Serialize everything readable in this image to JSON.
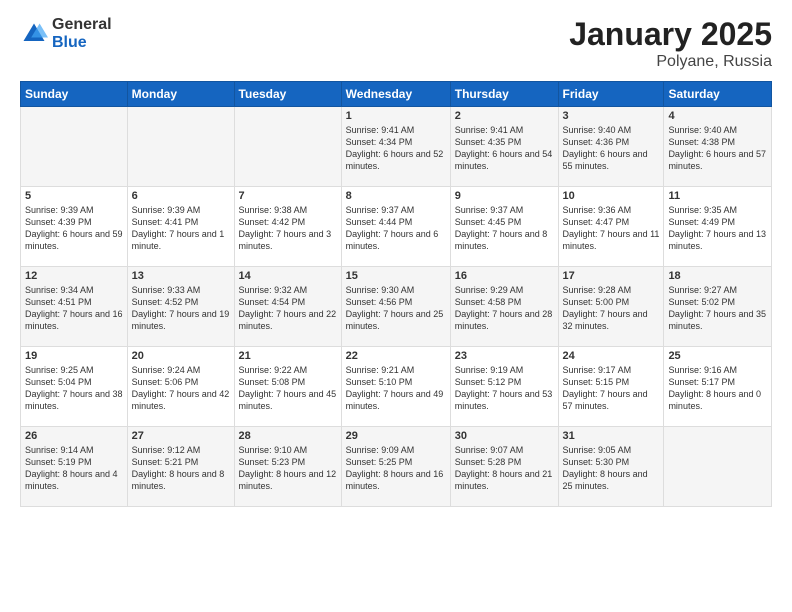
{
  "logo": {
    "general": "General",
    "blue": "Blue"
  },
  "title": {
    "month": "January 2025",
    "location": "Polyane, Russia"
  },
  "weekdays": [
    "Sunday",
    "Monday",
    "Tuesday",
    "Wednesday",
    "Thursday",
    "Friday",
    "Saturday"
  ],
  "weeks": [
    [
      {
        "day": "",
        "info": ""
      },
      {
        "day": "",
        "info": ""
      },
      {
        "day": "",
        "info": ""
      },
      {
        "day": "1",
        "info": "Sunrise: 9:41 AM\nSunset: 4:34 PM\nDaylight: 6 hours and 52 minutes."
      },
      {
        "day": "2",
        "info": "Sunrise: 9:41 AM\nSunset: 4:35 PM\nDaylight: 6 hours and 54 minutes."
      },
      {
        "day": "3",
        "info": "Sunrise: 9:40 AM\nSunset: 4:36 PM\nDaylight: 6 hours and 55 minutes."
      },
      {
        "day": "4",
        "info": "Sunrise: 9:40 AM\nSunset: 4:38 PM\nDaylight: 6 hours and 57 minutes."
      }
    ],
    [
      {
        "day": "5",
        "info": "Sunrise: 9:39 AM\nSunset: 4:39 PM\nDaylight: 6 hours and 59 minutes."
      },
      {
        "day": "6",
        "info": "Sunrise: 9:39 AM\nSunset: 4:41 PM\nDaylight: 7 hours and 1 minute."
      },
      {
        "day": "7",
        "info": "Sunrise: 9:38 AM\nSunset: 4:42 PM\nDaylight: 7 hours and 3 minutes."
      },
      {
        "day": "8",
        "info": "Sunrise: 9:37 AM\nSunset: 4:44 PM\nDaylight: 7 hours and 6 minutes."
      },
      {
        "day": "9",
        "info": "Sunrise: 9:37 AM\nSunset: 4:45 PM\nDaylight: 7 hours and 8 minutes."
      },
      {
        "day": "10",
        "info": "Sunrise: 9:36 AM\nSunset: 4:47 PM\nDaylight: 7 hours and 11 minutes."
      },
      {
        "day": "11",
        "info": "Sunrise: 9:35 AM\nSunset: 4:49 PM\nDaylight: 7 hours and 13 minutes."
      }
    ],
    [
      {
        "day": "12",
        "info": "Sunrise: 9:34 AM\nSunset: 4:51 PM\nDaylight: 7 hours and 16 minutes."
      },
      {
        "day": "13",
        "info": "Sunrise: 9:33 AM\nSunset: 4:52 PM\nDaylight: 7 hours and 19 minutes."
      },
      {
        "day": "14",
        "info": "Sunrise: 9:32 AM\nSunset: 4:54 PM\nDaylight: 7 hours and 22 minutes."
      },
      {
        "day": "15",
        "info": "Sunrise: 9:30 AM\nSunset: 4:56 PM\nDaylight: 7 hours and 25 minutes."
      },
      {
        "day": "16",
        "info": "Sunrise: 9:29 AM\nSunset: 4:58 PM\nDaylight: 7 hours and 28 minutes."
      },
      {
        "day": "17",
        "info": "Sunrise: 9:28 AM\nSunset: 5:00 PM\nDaylight: 7 hours and 32 minutes."
      },
      {
        "day": "18",
        "info": "Sunrise: 9:27 AM\nSunset: 5:02 PM\nDaylight: 7 hours and 35 minutes."
      }
    ],
    [
      {
        "day": "19",
        "info": "Sunrise: 9:25 AM\nSunset: 5:04 PM\nDaylight: 7 hours and 38 minutes."
      },
      {
        "day": "20",
        "info": "Sunrise: 9:24 AM\nSunset: 5:06 PM\nDaylight: 7 hours and 42 minutes."
      },
      {
        "day": "21",
        "info": "Sunrise: 9:22 AM\nSunset: 5:08 PM\nDaylight: 7 hours and 45 minutes."
      },
      {
        "day": "22",
        "info": "Sunrise: 9:21 AM\nSunset: 5:10 PM\nDaylight: 7 hours and 49 minutes."
      },
      {
        "day": "23",
        "info": "Sunrise: 9:19 AM\nSunset: 5:12 PM\nDaylight: 7 hours and 53 minutes."
      },
      {
        "day": "24",
        "info": "Sunrise: 9:17 AM\nSunset: 5:15 PM\nDaylight: 7 hours and 57 minutes."
      },
      {
        "day": "25",
        "info": "Sunrise: 9:16 AM\nSunset: 5:17 PM\nDaylight: 8 hours and 0 minutes."
      }
    ],
    [
      {
        "day": "26",
        "info": "Sunrise: 9:14 AM\nSunset: 5:19 PM\nDaylight: 8 hours and 4 minutes."
      },
      {
        "day": "27",
        "info": "Sunrise: 9:12 AM\nSunset: 5:21 PM\nDaylight: 8 hours and 8 minutes."
      },
      {
        "day": "28",
        "info": "Sunrise: 9:10 AM\nSunset: 5:23 PM\nDaylight: 8 hours and 12 minutes."
      },
      {
        "day": "29",
        "info": "Sunrise: 9:09 AM\nSunset: 5:25 PM\nDaylight: 8 hours and 16 minutes."
      },
      {
        "day": "30",
        "info": "Sunrise: 9:07 AM\nSunset: 5:28 PM\nDaylight: 8 hours and 21 minutes."
      },
      {
        "day": "31",
        "info": "Sunrise: 9:05 AM\nSunset: 5:30 PM\nDaylight: 8 hours and 25 minutes."
      },
      {
        "day": "",
        "info": ""
      }
    ]
  ]
}
